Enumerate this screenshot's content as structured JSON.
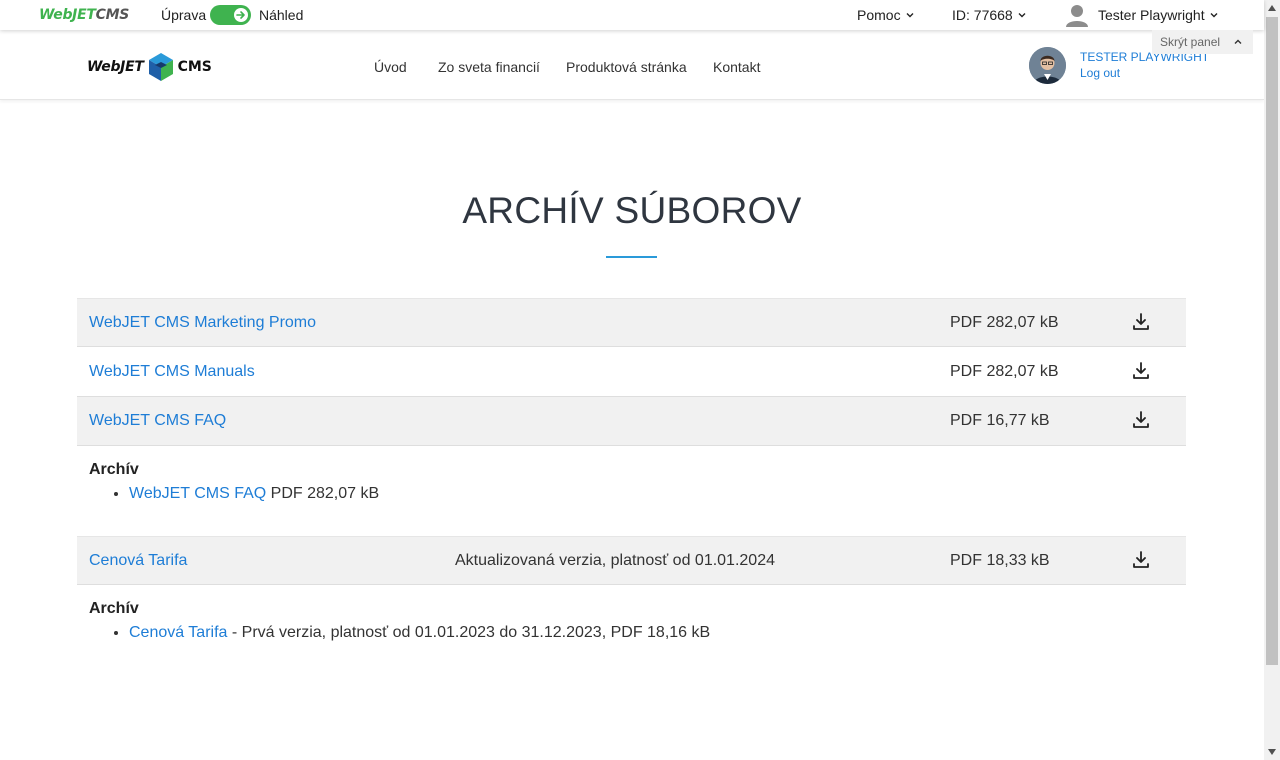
{
  "admin_bar": {
    "logo_green": "WebJET",
    "logo_dark": "CMS",
    "edit_label": "Úprava",
    "view_label": "Náhled",
    "help_label": "Pomoc",
    "page_id": "ID: 77668",
    "user_name": "Tester Playwright",
    "hide_panel": "Skrýt panel"
  },
  "header": {
    "logo_left": "WebJET",
    "logo_right": "CMS",
    "nav": [
      "Úvod",
      "Zo sveta financií",
      "Produktová stránka",
      "Kontakt"
    ],
    "account_name": "TESTER PLAYWRIGHT",
    "logout": "Log out"
  },
  "main": {
    "title": "ARCHÍV SÚBOROV",
    "files": [
      {
        "name": "WebJET CMS Marketing Promo",
        "description": "",
        "meta": "PDF 282,07 kB"
      },
      {
        "name": "WebJET CMS Manuals",
        "description": "",
        "meta": "PDF 282,07 kB"
      },
      {
        "name": "WebJET CMS FAQ",
        "description": "",
        "meta": "PDF 16,77 kB"
      },
      {
        "name": "Cenová Tarifa",
        "description": "Aktualizovaná verzia, platnosť od 01.01.2024",
        "meta": "PDF 18,33 kB"
      }
    ],
    "archives": [
      {
        "heading": "Archív",
        "link": "WebJET CMS FAQ",
        "text": " PDF 282,07 kB"
      },
      {
        "heading": "Archív",
        "link": "Cenová Tarifa",
        "text": " - Prvá verzia, platnosť od 01.01.2023 do 31.12.2023, PDF 18,16 kB"
      }
    ]
  },
  "icons": {
    "download": "download-icon",
    "chevron": "chevron-down-icon",
    "toggle_arrow": "arrow-right-icon",
    "user": "user-icon"
  },
  "colors": {
    "accent_green": "#3fb34f",
    "link_blue": "#1e7dd6",
    "title_underline": "#2a9ad9",
    "row_shade": "#f1f1f1"
  }
}
